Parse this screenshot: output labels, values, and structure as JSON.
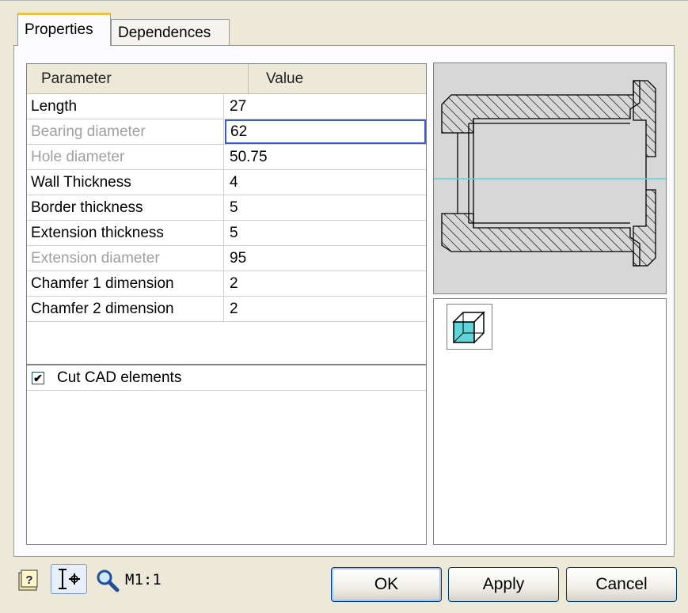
{
  "tabs": [
    {
      "label": "Properties",
      "active": true
    },
    {
      "label": "Dependences",
      "active": false
    }
  ],
  "grid": {
    "headers": [
      "Parameter",
      "Value"
    ],
    "rows": [
      {
        "param": "Length",
        "value": "27",
        "enabled": true
      },
      {
        "param": "Bearing diameter",
        "value": "62",
        "enabled": false
      },
      {
        "param": "Hole diameter",
        "value": "50.75",
        "enabled": false
      },
      {
        "param": "Wall Thickness",
        "value": "4",
        "enabled": true
      },
      {
        "param": "Border thickness",
        "value": "5",
        "enabled": true
      },
      {
        "param": "Extension thickness",
        "value": "5",
        "enabled": true
      },
      {
        "param": "Extension diameter",
        "value": "95",
        "enabled": false
      },
      {
        "param": "Chamfer 1 dimension",
        "value": "2",
        "enabled": true
      },
      {
        "param": "Chamfer 2 dimension",
        "value": "2",
        "enabled": true
      }
    ]
  },
  "options": {
    "cut_cad_label": "Cut CAD elements",
    "cut_cad_checked": true,
    "check_mark": "✔"
  },
  "toolbar": {
    "zoom_label": "M1:1",
    "help_icon": "?",
    "cursor_icon": "I⌖"
  },
  "buttons": {
    "ok": "OK",
    "apply": "Apply",
    "cancel": "Cancel"
  },
  "colors": {
    "centerline": "#4fd8e0",
    "cube_face": "#5fd5d9",
    "focus_border": "#3b5bd1"
  },
  "icons": {
    "preview": "bushing-section-preview",
    "view_3d": "cube-3d-icon",
    "zoom": "magnifier-icon"
  }
}
